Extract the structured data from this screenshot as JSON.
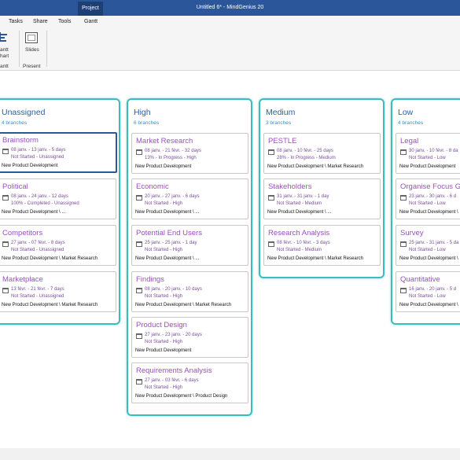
{
  "window": {
    "context_tab": "Project",
    "title": "Untitled 6* - MindGenius 20"
  },
  "menu": {
    "tasks": "Tasks",
    "share": "Share",
    "tools": "Tools",
    "gantt": "Gantt"
  },
  "ribbon": {
    "gantt_line1": "antt",
    "gantt_line2": "hart",
    "gantt_group": "antt",
    "slides": "Slides",
    "present_group": "Present"
  },
  "columns": [
    {
      "title": "Unassigned",
      "count": "4 branches",
      "cards": [
        {
          "title": "Brainstorm",
          "dates": "08 janv. - 13 janv. - 5 days",
          "status": "Not Started - Unassigned",
          "path": "New Product Development"
        },
        {
          "title": "Political",
          "dates": "08 janv. - 24 janv. - 12 days",
          "status": "100% - Completed - Unassigned",
          "path": "New Product Development \\ ..."
        },
        {
          "title": "Competitors",
          "dates": "27 janv. - 07 févr. - 8 days",
          "status": "Not Started - Unassigned",
          "path": "New Product Development \\ Market Research"
        },
        {
          "title": "Marketplace",
          "dates": "13 févr. - 21 févr. - 7 days",
          "status": "Not Started - Unassigned",
          "path": "New Product Development \\ Market Research"
        }
      ]
    },
    {
      "title": "High",
      "count": "6 branches",
      "cards": [
        {
          "title": "Market Research",
          "dates": "08 janv. - 21 févr. - 32 days",
          "status": "13% - In Progress - High",
          "path": "New Product Development"
        },
        {
          "title": "Economic",
          "dates": "20 janv. - 27 janv. - 6 days",
          "status": "Not Started - High",
          "path": "New Product Development \\ ..."
        },
        {
          "title": "Potential End Users",
          "dates": "25 janv. - 25 janv. - 1 day",
          "status": "Not Started - High",
          "path": "New Product Development \\ ..."
        },
        {
          "title": "Findings",
          "dates": "08 janv. - 20 janv. - 10 days",
          "status": "Not Started - High",
          "path": "New Product Development \\ Market Research"
        },
        {
          "title": "Product Design",
          "dates": "27 janv. - 23 janv. - 20 days",
          "status": "Not Started - High",
          "path": "New Product Development"
        },
        {
          "title": "Requirements Analysis",
          "dates": "27 janv. - 03 févr. - 6 days",
          "status": "Not Started - High",
          "path": "New Product Development \\ Product Design"
        }
      ]
    },
    {
      "title": "Medium",
      "count": "3 branches",
      "cards": [
        {
          "title": "PESTLE",
          "dates": "08 janv. - 10 févr. - 25 days",
          "status": "28% - In Progress - Medium",
          "path": "New Product Development \\ Market Research"
        },
        {
          "title": "Stakeholders",
          "dates": "31 janv. - 31 janv. - 1 day",
          "status": "Not Started - Medium",
          "path": "New Product Development \\ ..."
        },
        {
          "title": "Research Analysis",
          "dates": "08 févr. - 10 févr. - 3 days",
          "status": "Not Started - Medium",
          "path": "New Product Development \\ Market Research"
        }
      ]
    },
    {
      "title": "Low",
      "count": "4 branches",
      "cards": [
        {
          "title": "Legal",
          "dates": "30 janv. - 10 févr. - 8 da",
          "status": "Not Started - Low",
          "path": "New Product Development"
        },
        {
          "title": "Organise Focus G",
          "dates": "23 janv. - 30 janv. - 6 d",
          "status": "Not Started - Low",
          "path": "New Product Development \\"
        },
        {
          "title": "Survey",
          "dates": "25 janv. - 31 janv. - 5 da",
          "status": "Not Started - Low",
          "path": "New Product Development \\"
        },
        {
          "title": "Quantitative",
          "dates": "16 janv. - 20 janv. - 5 d",
          "status": "Not Started - Low",
          "path": "New Product Development \\"
        }
      ]
    }
  ]
}
